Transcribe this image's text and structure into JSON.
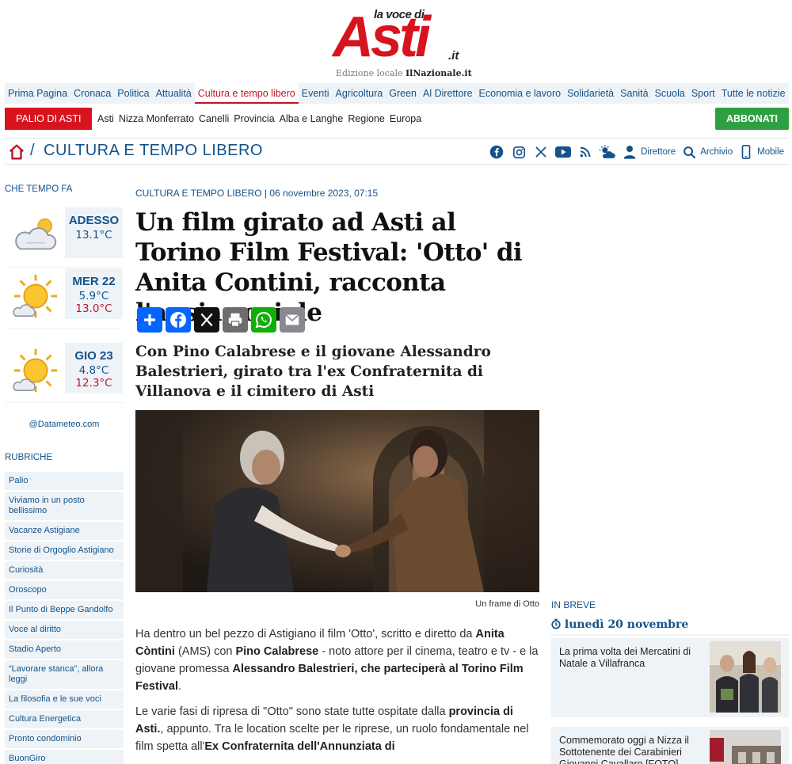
{
  "logo": {
    "small": "la voce di",
    "big": "Asti",
    "tld": ".it",
    "edition_prefix": "Edizione locale",
    "edition_brand": "IlNazionale.it"
  },
  "colors": {
    "brand_red": "#d7141e",
    "link_blue": "#14538a",
    "light_bg": "#eef3f7",
    "green": "#2ea043"
  },
  "main_nav": [
    "Prima Pagina",
    "Cronaca",
    "Politica",
    "Attualità",
    "Cultura e tempo libero",
    "Eventi",
    "Agricoltura",
    "Green",
    "Al Direttore",
    "Economia e lavoro",
    "Solidarietà",
    "Sanità",
    "Scuola",
    "Sport",
    "Tutte le notizie"
  ],
  "main_nav_active": "Cultura e tempo libero",
  "palio_button": "PALIO DI ASTI",
  "sub_nav": [
    "Asti",
    "Nizza Monferrato",
    "Canelli",
    "Provincia",
    "Alba e Langhe",
    "Regione",
    "Europa"
  ],
  "abbonati_button": "ABBONATI",
  "section": {
    "slash": "/",
    "title": "CULTURA E TEMPO LIBERO"
  },
  "toolbar": {
    "direttore": "Direttore",
    "archivio": "Archivio",
    "mobile": "Mobile"
  },
  "social_icons": [
    "facebook-icon",
    "instagram-icon",
    "x-icon",
    "youtube-icon",
    "rss-icon",
    "weather-icon",
    "user-icon",
    "search-icon",
    "mobile-icon"
  ],
  "weather": {
    "heading": "CHE TEMPO FA",
    "rows": [
      {
        "day": "ADESSO",
        "temp": "13.1°C",
        "icon": "cloudy-icon"
      },
      {
        "day": "MER 22",
        "min": "5.9°C",
        "max": "13.0°C",
        "icon": "sunny-cloud-icon"
      },
      {
        "day": "GIO 23",
        "min": "4.8°C",
        "max": "12.3°C",
        "icon": "sunny-cloud-icon"
      }
    ],
    "credit": "@Datameteo.com"
  },
  "rubriche": {
    "heading": "RUBRICHE",
    "items": [
      "Palio",
      "Viviamo in un posto bellissimo",
      "Vacanze Astigiane",
      "Storie di Orgoglio Astigiano",
      "Curiosità",
      "Oroscopo",
      "Il Punto di Beppe Gandolfo",
      "Voce al diritto",
      "Stadio Aperto",
      "“Lavorare stanca”, allora leggi",
      "La filosofia e le sue voci",
      "Cultura Energetica",
      "Pronto condominio",
      "BuonGiro"
    ]
  },
  "article": {
    "meta": "CULTURA E TEMPO LIBERO | 06 novembre 2023, 07:15",
    "title": "Un film girato ad Asti al Torino Film Festival: 'Otto' di Anita Contini, racconta l'ansia sociale",
    "subtitle": "Con Pino Calabrese e il giovane Alessandro Balestrieri, girato tra l'ex Confraternita di Villanova e il cimitero di Asti",
    "caption": "Un frame di Otto",
    "p1": {
      "a": "Ha dentro un bel pezzo di Astigiano il film 'Otto', scritto e diretto da ",
      "b": "Anita Còntini",
      "c": " (AMS) con ",
      "d": "Pino Calabrese",
      "e": " - noto attore per il cinema, teatro e tv - e la giovane promessa ",
      "f": "Alessandro Balestrieri, che parteciperà al Torino Film Festival",
      "g": "."
    },
    "p2": {
      "a": "Le varie fasi di ripresa di \"Otto\" sono state tutte ospitate dalla ",
      "b": "provincia di Asti.",
      "c": ", appunto. Tra le location scelte per le riprese, un ruolo fondamentale nel film spetta all'",
      "d": "Ex Confraternita dell'Annunziata di"
    }
  },
  "share_icons": [
    "add-share-icon",
    "facebook-share-icon",
    "x-share-icon",
    "print-icon",
    "whatsapp-icon",
    "email-icon"
  ],
  "breve": {
    "heading": "IN BREVE",
    "date": "lunedì 20 novembre",
    "items": [
      "La prima volta dei Mercatini di Natale a Villafranca",
      "Commemorato oggi a Nizza il Sottotenente dei Carabinieri Giovanni Cavallaro [FOTO]"
    ]
  }
}
